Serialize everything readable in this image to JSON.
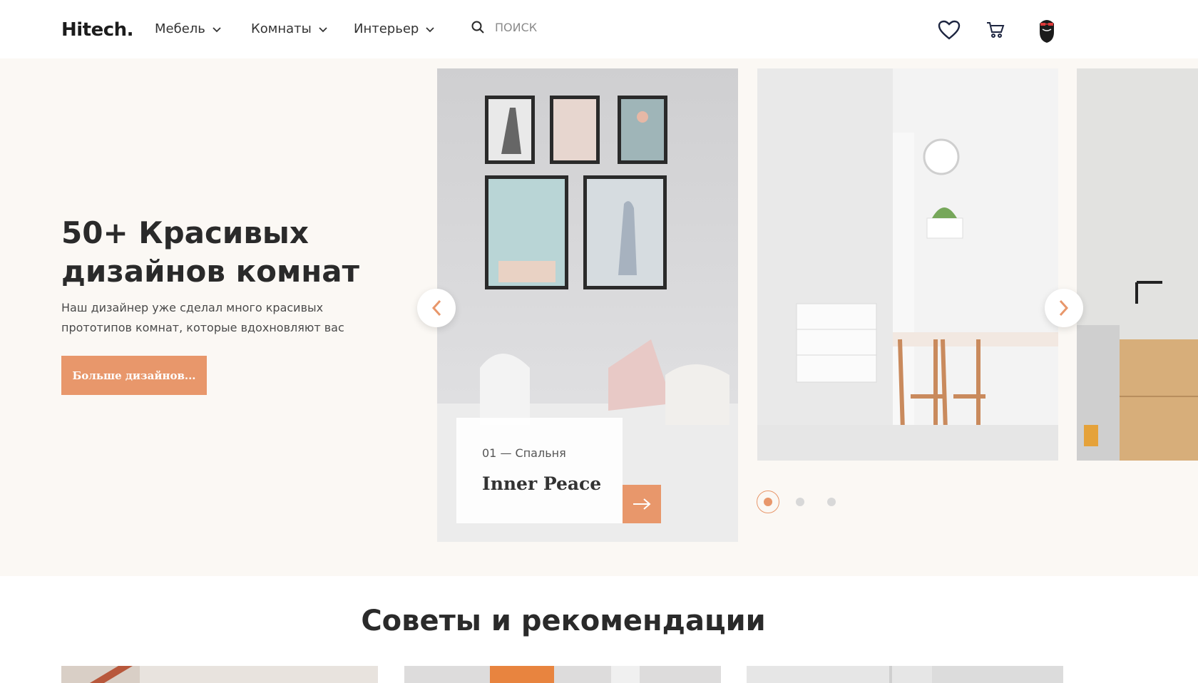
{
  "header": {
    "logo": "Hitech.",
    "nav": [
      {
        "label": "Мебель"
      },
      {
        "label": "Комнаты"
      },
      {
        "label": "Интерьер"
      }
    ],
    "search_placeholder": "ПОИСК"
  },
  "hero": {
    "title": "50+ Красивых дизайнов комнат",
    "text": "Наш дизайнер уже сделал много красивых прототипов комнат, которые вдохновляют вас",
    "cta_label": "Больше дизайнов...",
    "slide": {
      "meta": "01 — Спальня",
      "title": "Inner Peace"
    }
  },
  "tips": {
    "title": "Советы и рекомендации"
  },
  "colors": {
    "accent": "#e8976b",
    "hero_bg": "#fbf8f4"
  }
}
